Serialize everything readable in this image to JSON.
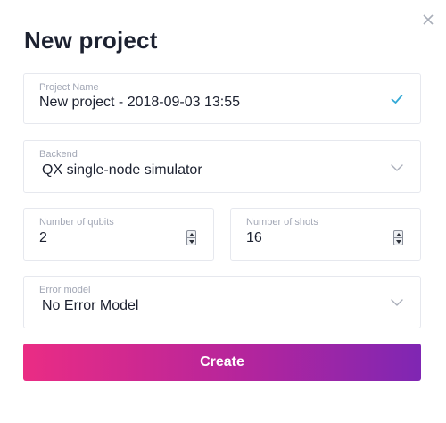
{
  "dialog": {
    "title": "New project",
    "close_icon": "close-icon"
  },
  "fields": {
    "project_name": {
      "label": "Project Name",
      "value": "New project - 2018-09-03 13:55",
      "status_icon": "check-icon"
    },
    "backend": {
      "label": "Backend",
      "value": "QX single-node simulator",
      "icon": "chevron-down-icon"
    },
    "qubits": {
      "label": "Number of qubits",
      "value": "2"
    },
    "shots": {
      "label": "Number of shots",
      "value": "16"
    },
    "error_model": {
      "label": "Error model",
      "value": "No Error Model",
      "icon": "chevron-down-icon"
    }
  },
  "actions": {
    "create_label": "Create"
  },
  "colors": {
    "title": "#1c2130",
    "label": "#a2a7b5",
    "border": "#e6e8ee",
    "check": "#33a9d6",
    "gradient_start": "#ea2c84",
    "gradient_end": "#7f26b3"
  }
}
